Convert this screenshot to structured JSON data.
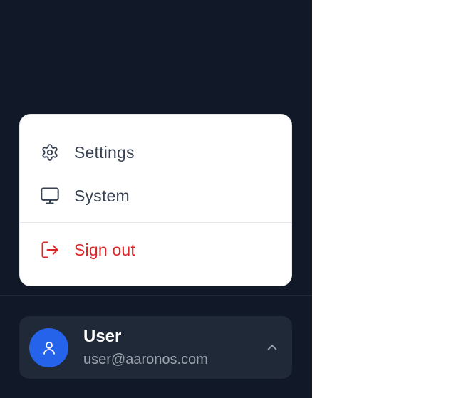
{
  "menu": {
    "items": [
      {
        "label": "Settings",
        "icon": "gear-icon"
      },
      {
        "label": "System",
        "icon": "monitor-icon"
      },
      {
        "label": "Sign out",
        "icon": "sign-out-icon"
      }
    ]
  },
  "user": {
    "name": "User",
    "email": "user@aaronos.com",
    "avatar_icon": "user-icon",
    "toggle_icon": "chevron-up-icon"
  },
  "colors": {
    "sidebar_bg": "#111827",
    "card_bg": "#1f2937",
    "accent": "#2563eb",
    "danger": "#dc2626",
    "text": "#374151"
  }
}
